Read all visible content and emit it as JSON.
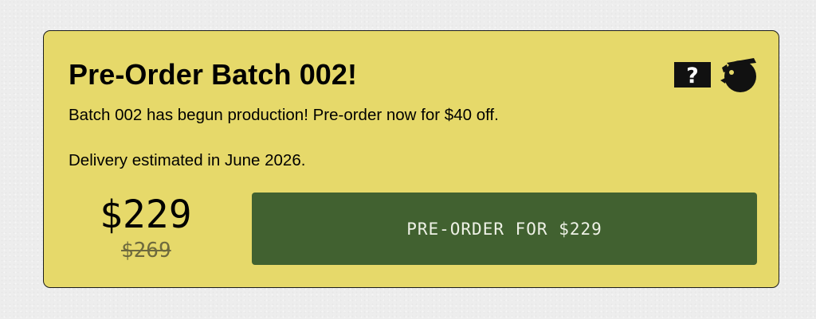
{
  "card": {
    "title": "Pre-Order Batch 002!",
    "description_line1": "Batch 002 has begun production! Pre-order now for $40 off.",
    "description_line2": "Delivery estimated in June 2026.",
    "logo_icon": "question-speech-bubble-bird-logo-icon",
    "logo_text": "?"
  },
  "pricing": {
    "current_price": "$229",
    "original_price": "$269"
  },
  "cta": {
    "label": "PRE-ORDER FOR $229"
  },
  "colors": {
    "card_background": "#e6d96a",
    "button_background": "#416130",
    "button_text": "#eef1e6",
    "page_background": "#ededed"
  }
}
